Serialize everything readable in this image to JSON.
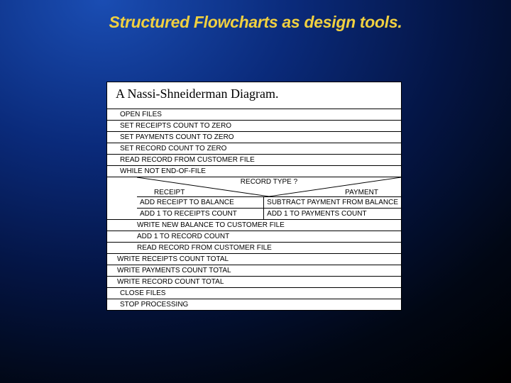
{
  "slide": {
    "title": "Structured Flowcharts as design tools."
  },
  "diagram": {
    "title": "A Nassi-Shneiderman Diagram.",
    "seq_top": [
      "OPEN FILES",
      "SET RECEIPTS COUNT TO ZERO",
      "SET PAYMENTS COUNT TO ZERO",
      "SET RECORD COUNT TO ZERO",
      "READ RECORD FROM CUSTOMER FILE",
      "WHILE NOT END-OF-FILE"
    ],
    "decision": {
      "question": "RECORD TYPE ?",
      "left_label": "RECEIPT",
      "right_label": "PAYMENT",
      "left_rows": [
        "ADD RECEIPT TO BALANCE",
        "ADD 1 TO RECEIPTS COUNT"
      ],
      "right_rows": [
        "SUBTRACT PAYMENT FROM BALANCE",
        "ADD 1 TO PAYMENTS COUNT"
      ]
    },
    "loop_tail": [
      "WRITE NEW BALANCE TO CUSTOMER FILE",
      "ADD 1 TO RECORD COUNT",
      "READ RECORD FROM CUSTOMER FILE"
    ],
    "seq_bottom": [
      "WRITE RECEIPTS COUNT TOTAL",
      "WRITE PAYMENTS COUNT TOTAL",
      "WRITE RECORD COUNT TOTAL",
      "CLOSE FILES",
      "STOP PROCESSING"
    ]
  }
}
